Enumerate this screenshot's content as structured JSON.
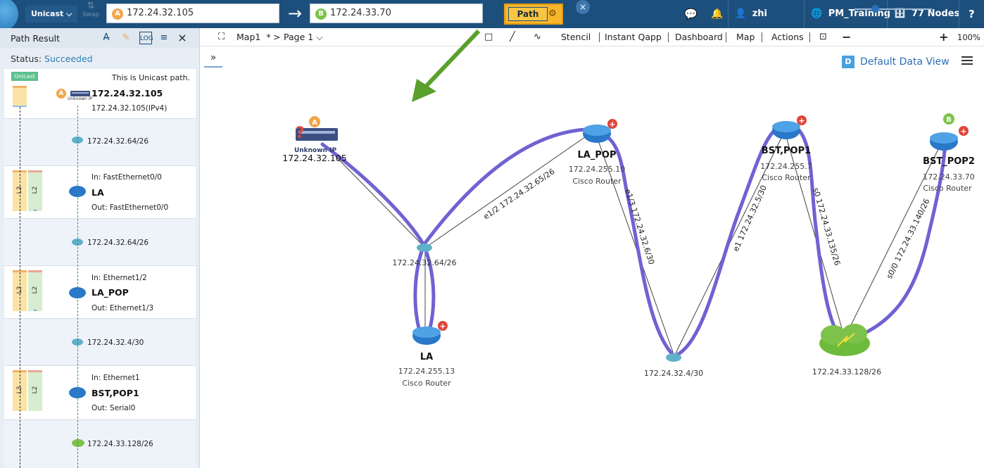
{
  "topbar": {
    "mode": "Unicast",
    "swap_label": "Swap",
    "source": {
      "badge": "A",
      "value": "172.24.32.105"
    },
    "destination": {
      "badge": "B",
      "value": "172.24.33.70"
    },
    "path_button": "Path",
    "user": "zhi",
    "domain": "PM_Training",
    "nodes": "77 Nodes",
    "help": "?"
  },
  "toolbar": {
    "map_name": "Map1",
    "modified_mark": "*",
    "breadcrumb_sep": ">",
    "page_name": "Page 1",
    "stencil": "Stencil",
    "instant_qapp": "Instant Qapp",
    "dashboard": "Dashboard",
    "map": "Map",
    "actions": "Actions",
    "zoom_level": "100%",
    "zoom_value": 0.25
  },
  "panel": {
    "title": "Path Result",
    "status_label": "Status:",
    "status_value": "Succeeded",
    "unicast_tag": "Unicast",
    "unicast_text": "This is Unicast path.",
    "hops": [
      {
        "name": "172.24.32.105",
        "sub": "172.24.32.105(IPv4)",
        "device_label": "Unknown IP"
      },
      {
        "subnet": "172.24.32.64/26"
      },
      {
        "name": "LA",
        "in": "In: FastEthernet0/0",
        "out": "Out: FastEthernet0/0",
        "l3": "L3",
        "l2": "L2"
      },
      {
        "subnet": "172.24.32.64/26"
      },
      {
        "name": "LA_POP",
        "in": "In: Ethernet1/2",
        "out": "Out: Ethernet1/3",
        "l3": "L3",
        "l2": "L2"
      },
      {
        "subnet": "172.24.32.4/30"
      },
      {
        "name": "BST,POP1",
        "in": "In: Ethernet1",
        "out": "Out: Serial0",
        "l3": "L3",
        "l2": "L2"
      },
      {
        "subnet": "172.24.33.128/26"
      }
    ]
  },
  "dataview": {
    "badge": "D",
    "label": "Default Data View"
  },
  "map_nodes": {
    "src_badge": "A",
    "dst_badge": "B",
    "unknown": {
      "label": "Unknown IP",
      "ip": "172.24.32.105"
    },
    "la": {
      "name": "LA",
      "ip": "172.24.255.13",
      "type": "Cisco Router"
    },
    "la_pop": {
      "name": "LA_POP",
      "ip": "172.24.255.10",
      "type": "Cisco Router"
    },
    "bst_pop1": {
      "name": "BST,POP1",
      "ip": "172.24.255.7",
      "type": "Cisco Router"
    },
    "bst_pop2": {
      "name": "BST_POP2",
      "ip": "172.24.33.70",
      "type": "Cisco Router"
    },
    "sub1": "172.24.32.64/26",
    "sub2": "172.24.32.4/30",
    "sub3": "172.24.33.128/26"
  },
  "link_labels": {
    "l1": "e1/2 172.24.32.65/26",
    "l2": "e1/3 172.24.32.6/30",
    "l3": "e1 172.24.32.5/30",
    "l4": "s0 172.24.33.135/26",
    "l5": "s0/0 172.24.33.140/26"
  },
  "colors": {
    "path": "#6f62d3",
    "topbar": "#1d4f7c",
    "accent": "#f7b62b",
    "badge_a": "#f0a64a",
    "badge_b": "#7dc24a",
    "status_ok": "#2d7fb8",
    "annotation_arrow": "#5aa02c"
  },
  "icons": [
    "swap-icon",
    "arrow-right-icon",
    "gear-icon",
    "close-icon",
    "chat-icon",
    "bell-icon",
    "user-icon",
    "globe-icon",
    "database-icon",
    "help-icon",
    "fit-view-icon",
    "rectangle-icon",
    "line-icon",
    "curve-icon",
    "fit-screen-icon",
    "menu-icon",
    "router-icon",
    "cloud-icon",
    "subnet-icon"
  ]
}
